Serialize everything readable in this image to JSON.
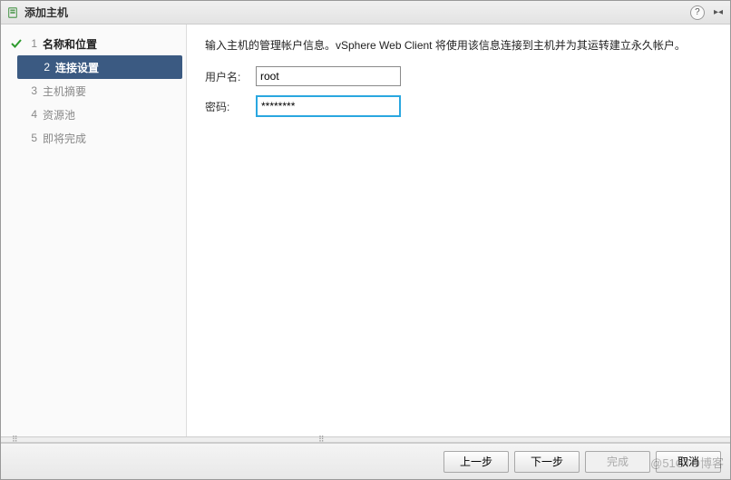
{
  "title": "添加主机",
  "help_tooltip": "?",
  "steps": [
    {
      "num": "1",
      "label": "名称和位置",
      "state": "done"
    },
    {
      "num": "2",
      "label": "连接设置",
      "state": "active"
    },
    {
      "num": "3",
      "label": "主机摘要",
      "state": "pending"
    },
    {
      "num": "4",
      "label": "资源池",
      "state": "pending"
    },
    {
      "num": "5",
      "label": "即将完成",
      "state": "pending"
    }
  ],
  "instruction": "输入主机的管理帐户信息。vSphere Web Client 将使用该信息连接到主机并为其运转建立永久帐户。",
  "form": {
    "username_label": "用户名:",
    "username_value": "root",
    "password_label": "密码:",
    "password_value": "********"
  },
  "buttons": {
    "back": "上一步",
    "next": "下一步",
    "finish": "完成",
    "cancel": "取消"
  },
  "watermark": "@51CTO博客"
}
